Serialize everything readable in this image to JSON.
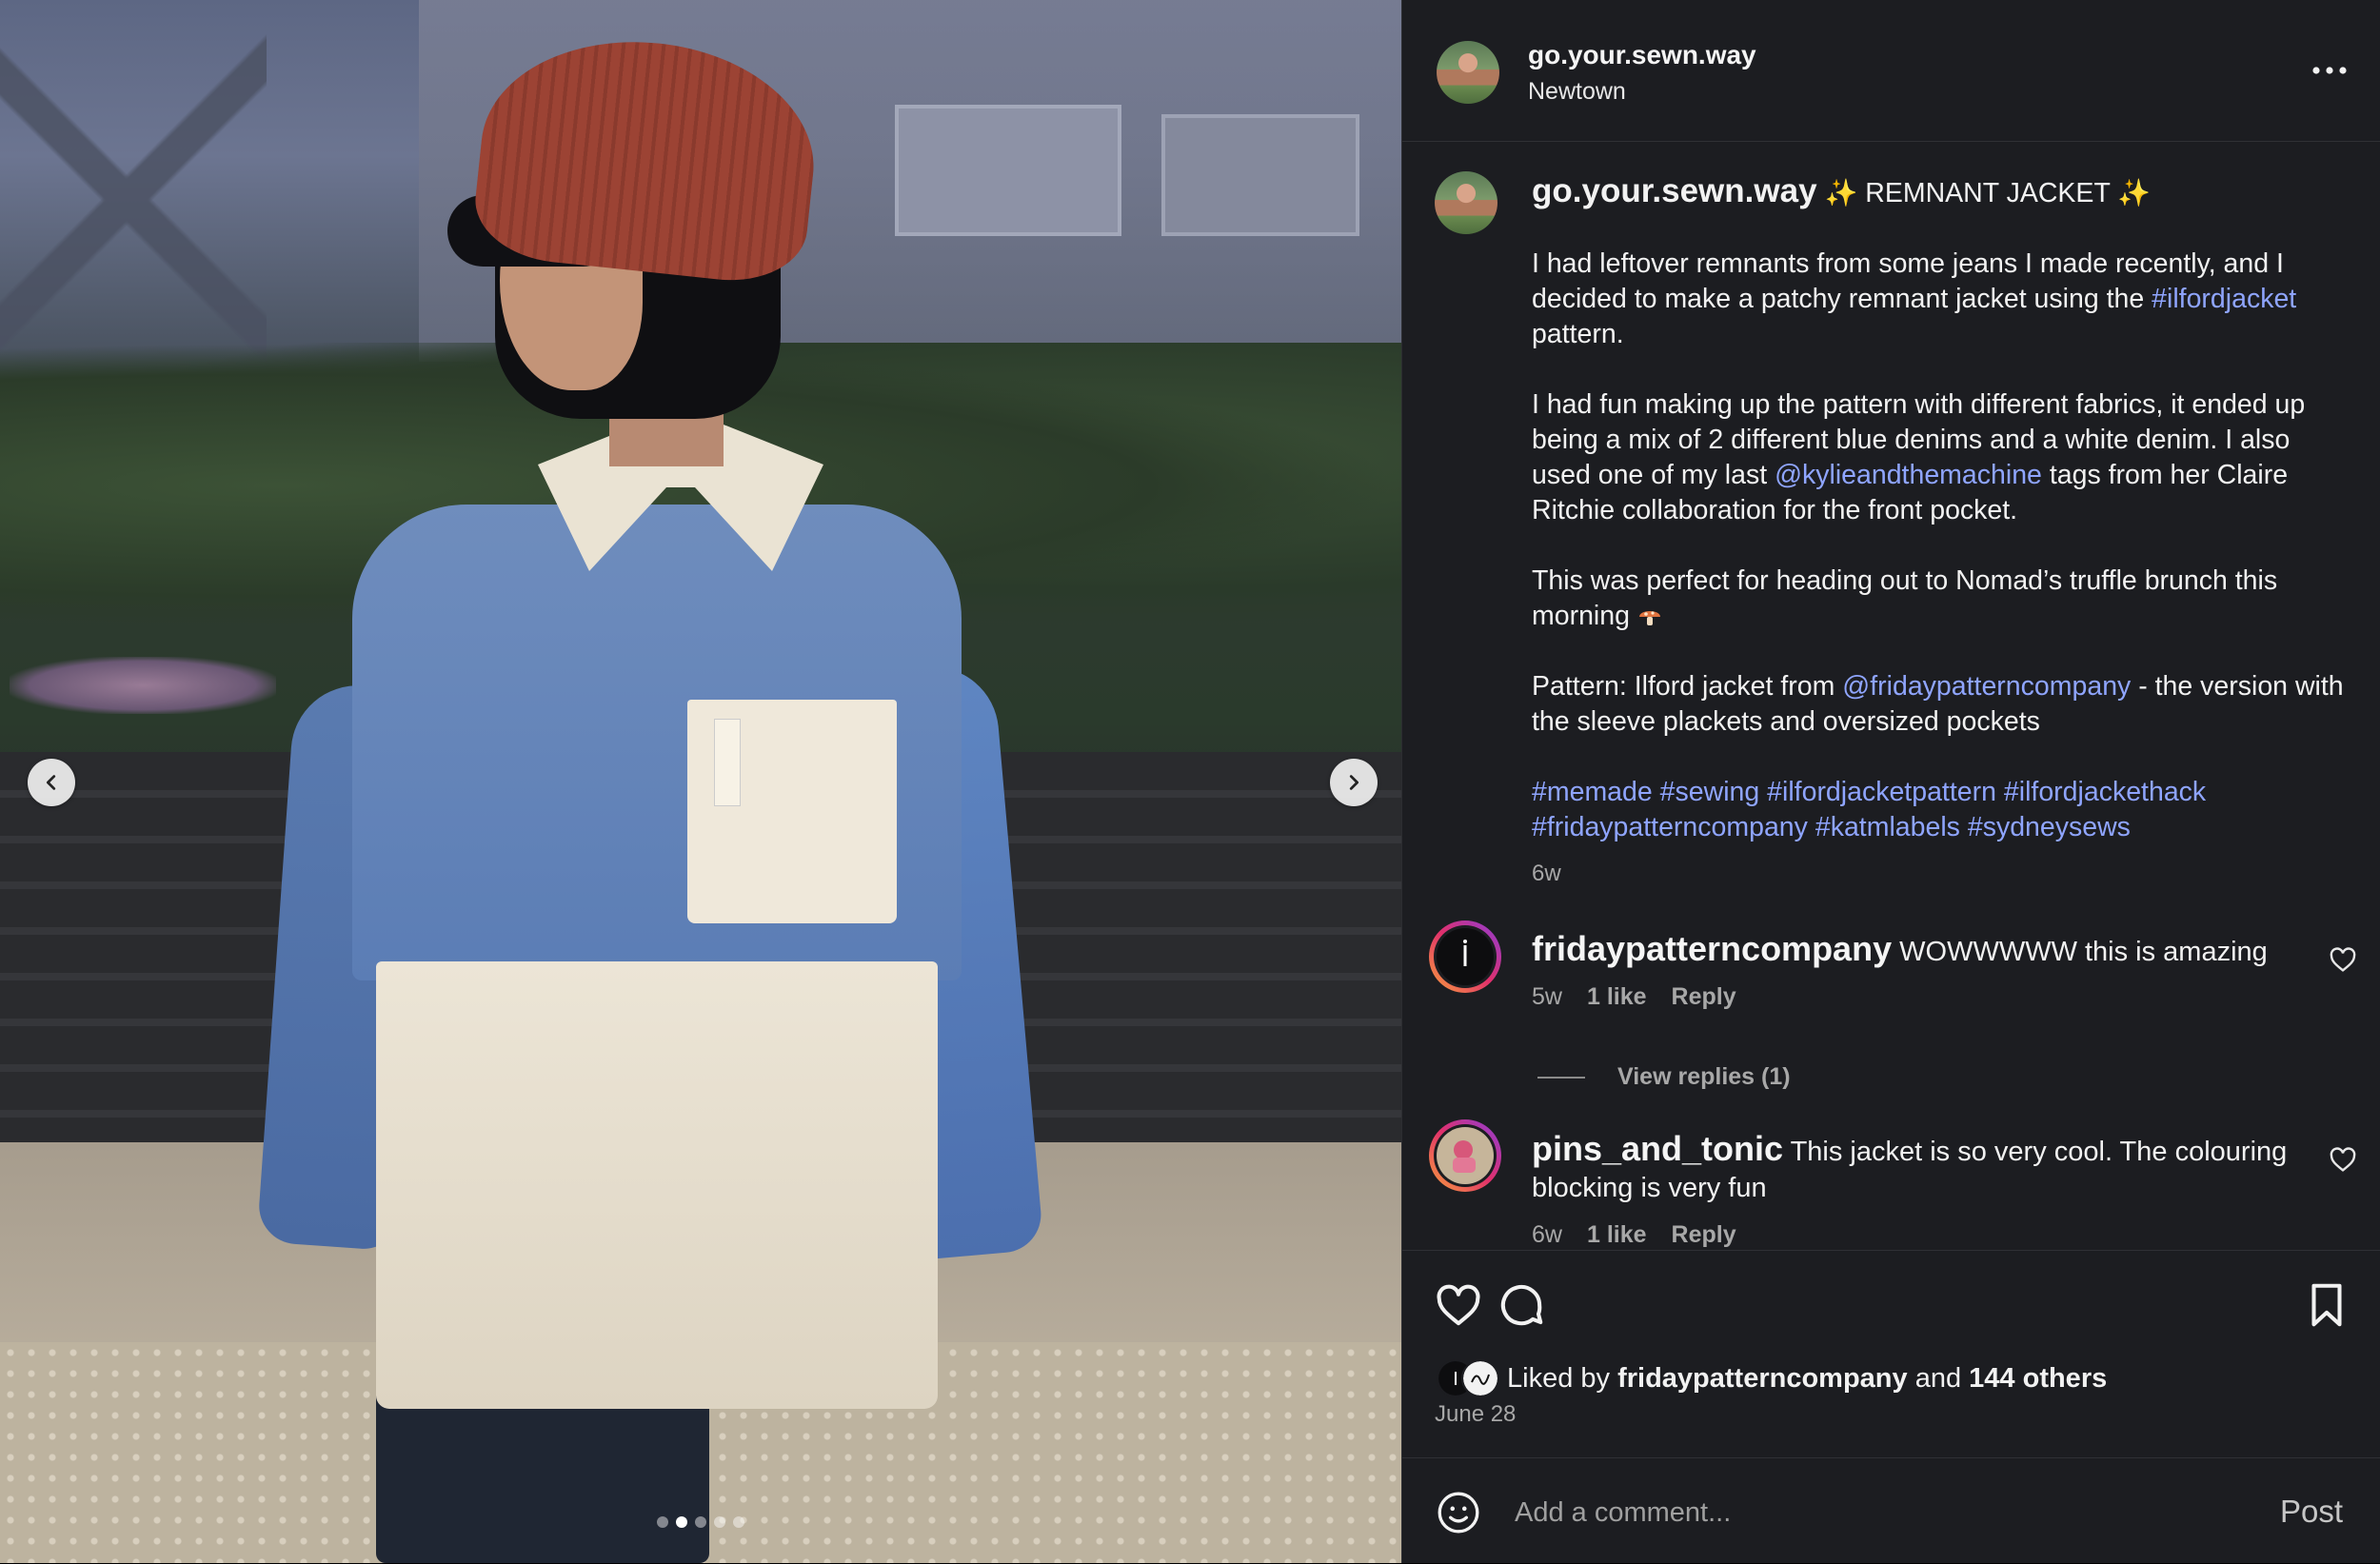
{
  "post": {
    "username": "go.your.sewn.way",
    "location": "Newtown",
    "carousel": {
      "total": 5,
      "current": 2
    },
    "caption": {
      "title": " REMNANT JACKET ",
      "p1_a": "I had leftover remnants from some jeans I made recently, and I decided to make a patchy remnant jacket using the ",
      "p1_tag": "#ilfordjacket",
      "p1_b": " pattern.",
      "p2_a": "I had fun making up the pattern with different fabrics, it ended up being a mix of 2 different blue denims and a white denim. I also used one of my last ",
      "p2_mention": "@kylieandthemachine",
      "p2_b": " tags from her Claire Ritchie collaboration for the front pocket.",
      "p3": "This was perfect for heading out to Nomad’s truffle brunch this morning ",
      "p4_a": "Pattern: Ilford jacket from ",
      "p4_mention": "@fridaypatterncompany",
      "p4_b": " - the version with the sleeve plackets and oversized pockets",
      "hashtags": [
        "#memade",
        "#sewing",
        "#ilfordjacketpattern",
        "#ilfordjackethack",
        "#fridaypatterncompany",
        "#katmlabels",
        "#sydneysews"
      ],
      "time": "6w"
    },
    "comments": [
      {
        "username": "fridaypatterncompany",
        "text": " WOWWWWW this is amazing",
        "time": "5w",
        "likes": "1 like",
        "reply": "Reply",
        "view_replies": "View replies (1)"
      },
      {
        "username": "pins_and_tonic",
        "text": " This jacket is so very cool. The colouring blocking is very fun",
        "time": "6w",
        "likes": "1 like",
        "reply": "Reply"
      }
    ],
    "likes": {
      "prefix": "Liked by ",
      "user": "fridaypatterncompany",
      "middle": " and ",
      "count": "144 others"
    },
    "date": "June 28",
    "comment_box": {
      "placeholder": "Add a comment...",
      "post_label": "Post"
    }
  },
  "icons": {
    "more": "more-horizontal-icon",
    "prev": "chevron-left-icon",
    "next": "chevron-right-icon",
    "like": "heart-icon",
    "comment": "comment-bubble-icon",
    "save": "bookmark-icon",
    "emoji": "emoji-smile-icon"
  },
  "colors": {
    "link": "#8fa5ff",
    "panel_bg": "#1c1d21",
    "meta_text": "#a8a8a8"
  }
}
